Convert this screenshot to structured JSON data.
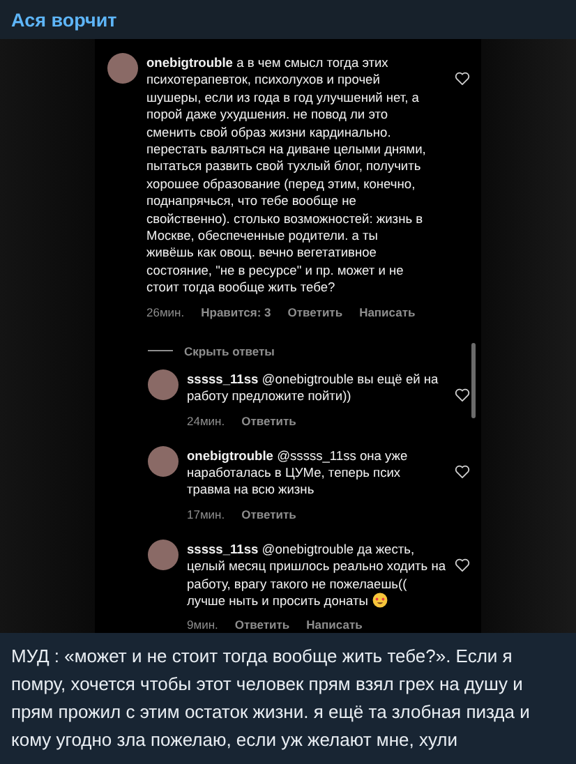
{
  "channel": {
    "title": "Ася ворчит"
  },
  "comments": [
    {
      "username": "onebigtrouble",
      "text": "а в чем смысл тогда этих психотерапевток, психолухов и прочей шушеры, если из года в год улучшений нет, а порой даже ухудшения. не повод ли это сменить свой образ жизни кардинально. перестать валяться на диване целыми днями, пытаться развить свой тухлый блог, получить хорошее образование (перед этим, конечно, поднапрячься, что тебе вообще не свойственно). столько возможностей: жизнь в Москве, обеспеченные родители. а ты живёшь как овощ. вечно вегетативное состояние, \"не в ресурсе\" и пр. может и не стоит тогда вообще жить тебе?",
      "time": "26мин.",
      "actions": [
        "Нравится: 3",
        "Ответить",
        "Написать"
      ],
      "replies_toggle": "Скрыть ответы",
      "replies": [
        {
          "username": "sssss_11ss",
          "text": "@onebigtrouble вы ещё ей на работу предложите пойти))",
          "time": "24мин.",
          "actions": [
            "Ответить"
          ],
          "emoji": false
        },
        {
          "username": "onebigtrouble",
          "text": "@sssss_11ss она уже наработалась в ЦУМе, теперь псих травма на всю жизнь",
          "time": "17мин.",
          "actions": [
            "Ответить"
          ],
          "emoji": false
        },
        {
          "username": "sssss_11ss",
          "text": "@onebigtrouble да жесть, целый месяц пришлось реально ходить на работу, врагу такого не пожелаешь(( лучше ныть и просить донаты",
          "time": "9мин.",
          "actions": [
            "Ответить",
            "Написать"
          ],
          "emoji": true
        }
      ]
    }
  ],
  "caption": {
    "text": "МУД : «может и не стоит тогда вообще жить тебе?». Если я помру, хочется чтобы этот человек прям взял грех на душу и прям прожил с этим остаток жизни. я ещё та злобная пизда и кому угодно зла пожелаю, если уж желают мне, хули"
  }
}
